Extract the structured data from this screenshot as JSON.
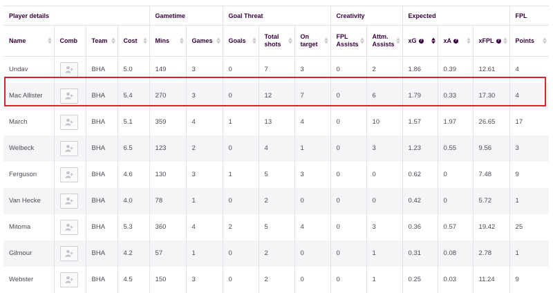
{
  "groups": [
    {
      "label": "Player details",
      "span": 4
    },
    {
      "label": "Gametime",
      "span": 2
    },
    {
      "label": "Goal Threat",
      "span": 3
    },
    {
      "label": "Creativity",
      "span": 2
    },
    {
      "label": "Expected",
      "span": 3
    },
    {
      "label": "FPL",
      "span": 1
    }
  ],
  "columns": [
    {
      "key": "name",
      "label": "Name",
      "sortable": true
    },
    {
      "key": "comb",
      "label": "Comb",
      "sortable": false
    },
    {
      "key": "team",
      "label": "Team",
      "sortable": true
    },
    {
      "key": "cost",
      "label": "Cost",
      "sortable": true
    },
    {
      "key": "mins",
      "label": "Mins",
      "sortable": true
    },
    {
      "key": "games",
      "label": "Games",
      "sortable": true
    },
    {
      "key": "goals",
      "label": "Goals",
      "sortable": true
    },
    {
      "key": "shots",
      "label": "Total shots",
      "sortable": true
    },
    {
      "key": "on_target",
      "label": "On target",
      "sortable": true
    },
    {
      "key": "fpl_assists",
      "label": "FPL Assists",
      "sortable": true
    },
    {
      "key": "attm_assists",
      "label": "Attm. Assists",
      "sortable": true
    },
    {
      "key": "xg",
      "label": "xG",
      "sortable": true,
      "info": true,
      "active": true
    },
    {
      "key": "xa",
      "label": "xA",
      "sortable": true,
      "info": true
    },
    {
      "key": "xfpl",
      "label": "xFPL",
      "sortable": true,
      "info": true
    },
    {
      "key": "points",
      "label": "Points",
      "sortable": true
    }
  ],
  "info_glyph": "?",
  "comb_icon": "add-user-icon",
  "highlight_color": "#d9232d",
  "rows": [
    {
      "name": "Undav",
      "team": "BHA",
      "cost": "5.0",
      "mins": "149",
      "games": "3",
      "goals": "0",
      "shots": "7",
      "on_target": "3",
      "fpl_assists": "0",
      "attm_assists": "2",
      "xg": "1.86",
      "xa": "0.39",
      "xfpl": "12.61",
      "points": "4"
    },
    {
      "name": "Mac Allister",
      "team": "BHA",
      "cost": "5.4",
      "mins": "270",
      "games": "3",
      "goals": "0",
      "shots": "12",
      "on_target": "7",
      "fpl_assists": "0",
      "attm_assists": "6",
      "xg": "1.79",
      "xa": "0.33",
      "xfpl": "17.30",
      "points": "4",
      "highlighted": true
    },
    {
      "name": "March",
      "team": "BHA",
      "cost": "5.1",
      "mins": "359",
      "games": "4",
      "goals": "1",
      "shots": "13",
      "on_target": "4",
      "fpl_assists": "0",
      "attm_assists": "10",
      "xg": "1.57",
      "xa": "1.97",
      "xfpl": "26.65",
      "points": "17"
    },
    {
      "name": "Welbeck",
      "team": "BHA",
      "cost": "6.5",
      "mins": "123",
      "games": "2",
      "goals": "0",
      "shots": "4",
      "on_target": "1",
      "fpl_assists": "0",
      "attm_assists": "3",
      "xg": "1.23",
      "xa": "0.55",
      "xfpl": "9.56",
      "points": "3"
    },
    {
      "name": "Ferguson",
      "team": "BHA",
      "cost": "4.6",
      "mins": "130",
      "games": "3",
      "goals": "1",
      "shots": "5",
      "on_target": "3",
      "fpl_assists": "0",
      "attm_assists": "0",
      "xg": "0.62",
      "xa": "0",
      "xfpl": "7.48",
      "points": "9"
    },
    {
      "name": "Van Hecke",
      "team": "BHA",
      "cost": "4.0",
      "mins": "78",
      "games": "1",
      "goals": "0",
      "shots": "2",
      "on_target": "0",
      "fpl_assists": "0",
      "attm_assists": "0",
      "xg": "0.42",
      "xa": "0",
      "xfpl": "5.72",
      "points": "1"
    },
    {
      "name": "Mitoma",
      "team": "BHA",
      "cost": "5.3",
      "mins": "360",
      "games": "4",
      "goals": "2",
      "shots": "5",
      "on_target": "4",
      "fpl_assists": "0",
      "attm_assists": "3",
      "xg": "0.36",
      "xa": "0.57",
      "xfpl": "19.42",
      "points": "25"
    },
    {
      "name": "Gilmour",
      "team": "BHA",
      "cost": "4.2",
      "mins": "57",
      "games": "1",
      "goals": "0",
      "shots": "2",
      "on_target": "0",
      "fpl_assists": "0",
      "attm_assists": "1",
      "xg": "0.31",
      "xa": "0.08",
      "xfpl": "2.78",
      "points": "1"
    },
    {
      "name": "Webster",
      "team": "BHA",
      "cost": "4.5",
      "mins": "150",
      "games": "3",
      "goals": "0",
      "shots": "2",
      "on_target": "0",
      "fpl_assists": "0",
      "attm_assists": "1",
      "xg": "0.25",
      "xa": "0.03",
      "xfpl": "11.24",
      "points": "9"
    }
  ]
}
